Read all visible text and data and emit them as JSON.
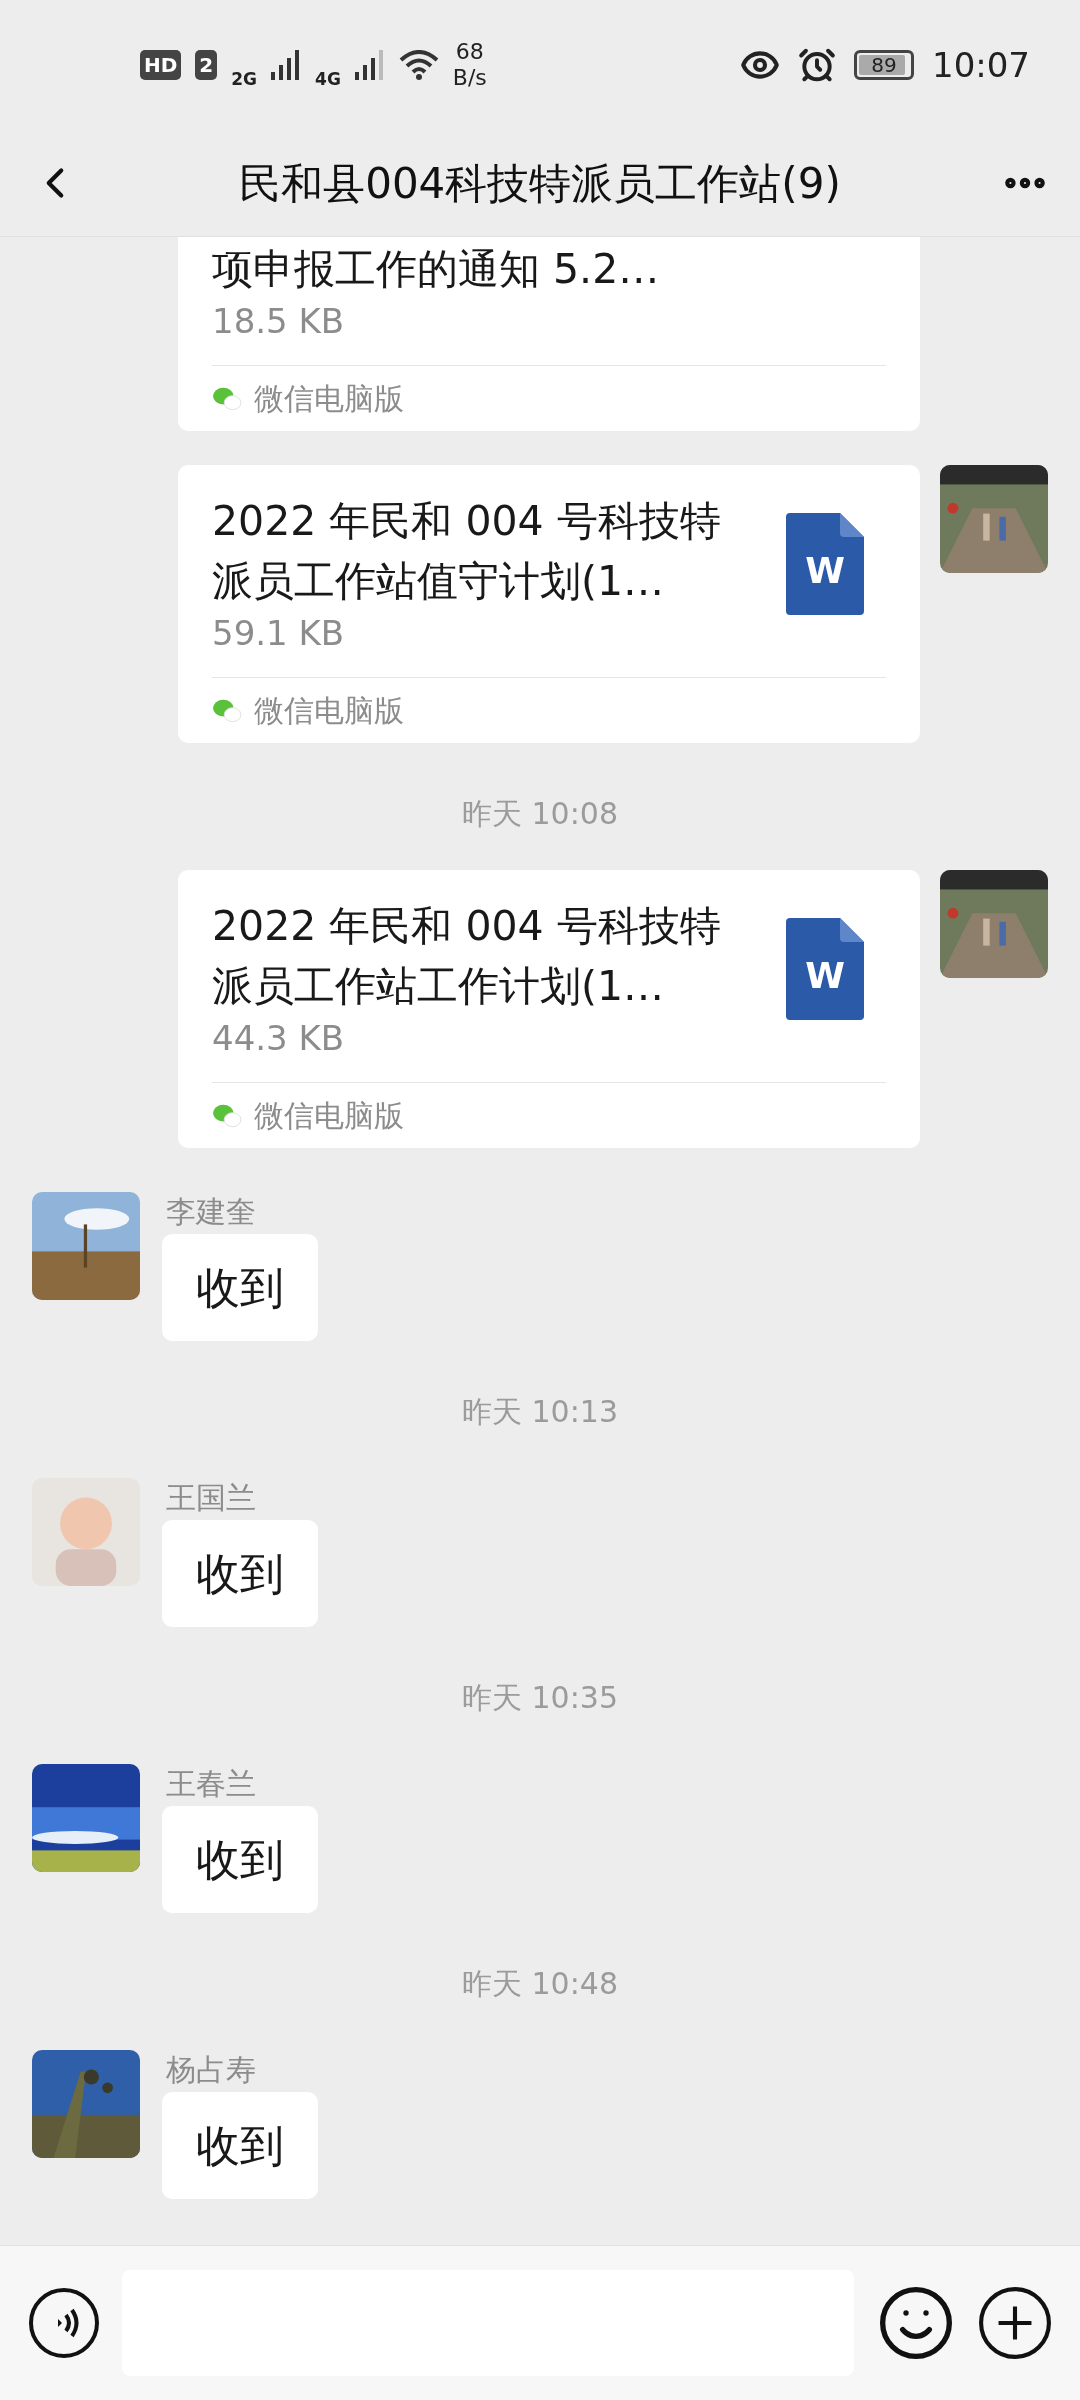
{
  "status_bar": {
    "hd": "HD",
    "sim": "2",
    "net1": "2G",
    "net2": "4G",
    "speed_value": "68",
    "speed_unit": "B/s",
    "battery": "89",
    "time": "10:07"
  },
  "header": {
    "title": "民和县004科技特派员工作站(9)"
  },
  "messages": [
    {
      "kind": "file",
      "cut_top": true,
      "title_lines": [
        "项申报工作的通知 5.2…"
      ],
      "size": "18.5 KB",
      "source": "微信电脑版"
    },
    {
      "kind": "file",
      "cut_top": false,
      "title_lines": [
        "2022 年民和 004 号科技特",
        "派员工作站值守计划(1…"
      ],
      "size": "59.1 KB",
      "icon_letter": "W",
      "source": "微信电脑版"
    },
    {
      "kind": "time",
      "text": "昨天 10:08"
    },
    {
      "kind": "file",
      "cut_top": false,
      "title_lines": [
        "2022 年民和 004 号科技特",
        "派员工作站工作计划(1…"
      ],
      "size": "44.3 KB",
      "icon_letter": "W",
      "source": "微信电脑版"
    },
    {
      "kind": "text",
      "sender": "李建奎",
      "text": "收到"
    },
    {
      "kind": "time",
      "text": "昨天 10:13"
    },
    {
      "kind": "text",
      "sender": "王国兰",
      "text": "收到"
    },
    {
      "kind": "time",
      "text": "昨天 10:35"
    },
    {
      "kind": "text",
      "sender": "王春兰",
      "text": "收到"
    },
    {
      "kind": "time",
      "text": "昨天 10:48"
    },
    {
      "kind": "text",
      "sender": "杨占寿",
      "text": "收到"
    }
  ]
}
